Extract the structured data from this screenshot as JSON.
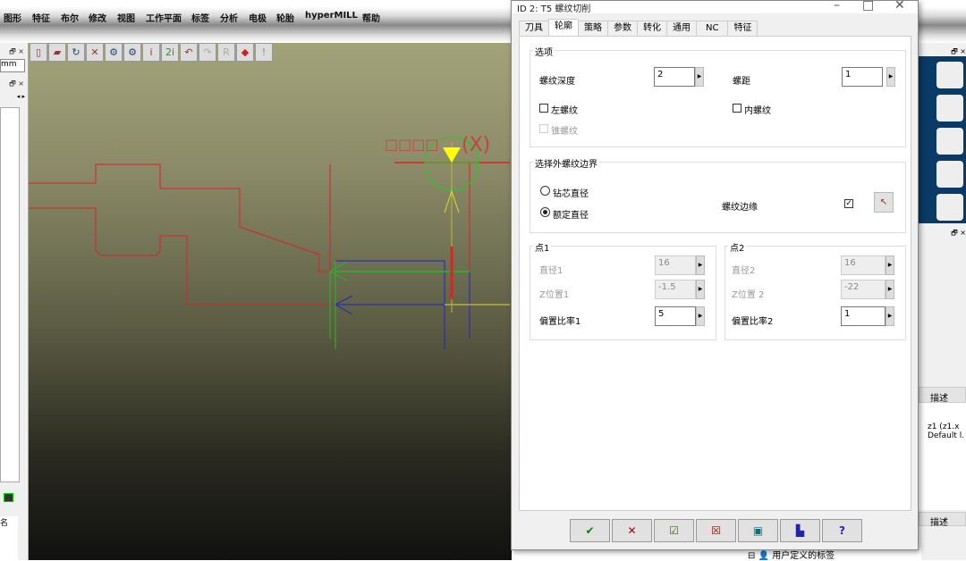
{
  "menu": [
    "图形",
    "特征",
    "布尔",
    "修改",
    "视图",
    "工作平面",
    "标签",
    "分析",
    "电极",
    "轮胎",
    "hyperMILL",
    "帮助"
  ],
  "left": {
    "unit": "mm",
    "bottom_char": "名"
  },
  "viewport": {
    "label": "(X)"
  },
  "dialog": {
    "title": "ID 2: T5 螺纹切削",
    "tabs": [
      "刀具",
      "轮廓",
      "策略",
      "参数",
      "转化",
      "通用",
      "NC",
      "特征"
    ],
    "active_tab": "轮廓",
    "options": {
      "legend": "选项",
      "thread_depth_label": "螺纹深度",
      "thread_depth": "2",
      "pitch_label": "螺距",
      "pitch": "1",
      "left_thread": "左螺纹",
      "left_thread_checked": false,
      "inner_thread": "内螺纹",
      "inner_thread_checked": false,
      "taper_thread": "锥螺纹",
      "taper_thread_checked": false
    },
    "boundary": {
      "legend": "选择外螺纹边界",
      "core_dia": "钻芯直径",
      "nominal_dia": "额定直径",
      "selected": "额定直径",
      "thread_edge": "螺纹边缘",
      "thread_edge_checked": true
    },
    "point1": {
      "legend": "点1",
      "dia_label": "直径1",
      "dia": "16",
      "z_label": "Z位置1",
      "z": "-1.5",
      "offset_label": "偏置比率1",
      "offset": "5"
    },
    "point2": {
      "legend": "点2",
      "dia_label": "直径2",
      "dia": "16",
      "z_label": "Z位置 2",
      "z": "-22",
      "offset_label": "偏置比率2",
      "offset": "1"
    }
  },
  "right": {
    "desc_header": "描述",
    "desc_text1": "z1 (z1.x",
    "desc_text2": "Default l.",
    "desc_header2": "描述",
    "tree_item": "用户定义的标签"
  }
}
